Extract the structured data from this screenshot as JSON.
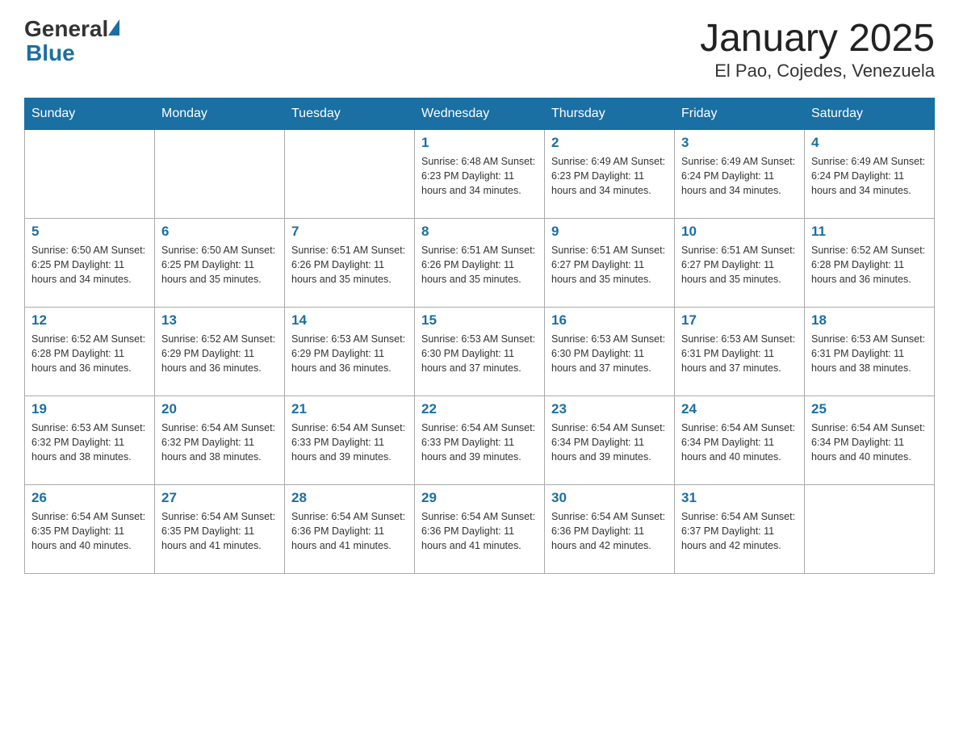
{
  "header": {
    "title": "January 2025",
    "subtitle": "El Pao, Cojedes, Venezuela"
  },
  "logo": {
    "general": "General",
    "blue": "Blue"
  },
  "days_of_week": [
    "Sunday",
    "Monday",
    "Tuesday",
    "Wednesday",
    "Thursday",
    "Friday",
    "Saturday"
  ],
  "weeks": [
    [
      {
        "day": "",
        "info": ""
      },
      {
        "day": "",
        "info": ""
      },
      {
        "day": "",
        "info": ""
      },
      {
        "day": "1",
        "info": "Sunrise: 6:48 AM\nSunset: 6:23 PM\nDaylight: 11 hours\nand 34 minutes."
      },
      {
        "day": "2",
        "info": "Sunrise: 6:49 AM\nSunset: 6:23 PM\nDaylight: 11 hours\nand 34 minutes."
      },
      {
        "day": "3",
        "info": "Sunrise: 6:49 AM\nSunset: 6:24 PM\nDaylight: 11 hours\nand 34 minutes."
      },
      {
        "day": "4",
        "info": "Sunrise: 6:49 AM\nSunset: 6:24 PM\nDaylight: 11 hours\nand 34 minutes."
      }
    ],
    [
      {
        "day": "5",
        "info": "Sunrise: 6:50 AM\nSunset: 6:25 PM\nDaylight: 11 hours\nand 34 minutes."
      },
      {
        "day": "6",
        "info": "Sunrise: 6:50 AM\nSunset: 6:25 PM\nDaylight: 11 hours\nand 35 minutes."
      },
      {
        "day": "7",
        "info": "Sunrise: 6:51 AM\nSunset: 6:26 PM\nDaylight: 11 hours\nand 35 minutes."
      },
      {
        "day": "8",
        "info": "Sunrise: 6:51 AM\nSunset: 6:26 PM\nDaylight: 11 hours\nand 35 minutes."
      },
      {
        "day": "9",
        "info": "Sunrise: 6:51 AM\nSunset: 6:27 PM\nDaylight: 11 hours\nand 35 minutes."
      },
      {
        "day": "10",
        "info": "Sunrise: 6:51 AM\nSunset: 6:27 PM\nDaylight: 11 hours\nand 35 minutes."
      },
      {
        "day": "11",
        "info": "Sunrise: 6:52 AM\nSunset: 6:28 PM\nDaylight: 11 hours\nand 36 minutes."
      }
    ],
    [
      {
        "day": "12",
        "info": "Sunrise: 6:52 AM\nSunset: 6:28 PM\nDaylight: 11 hours\nand 36 minutes."
      },
      {
        "day": "13",
        "info": "Sunrise: 6:52 AM\nSunset: 6:29 PM\nDaylight: 11 hours\nand 36 minutes."
      },
      {
        "day": "14",
        "info": "Sunrise: 6:53 AM\nSunset: 6:29 PM\nDaylight: 11 hours\nand 36 minutes."
      },
      {
        "day": "15",
        "info": "Sunrise: 6:53 AM\nSunset: 6:30 PM\nDaylight: 11 hours\nand 37 minutes."
      },
      {
        "day": "16",
        "info": "Sunrise: 6:53 AM\nSunset: 6:30 PM\nDaylight: 11 hours\nand 37 minutes."
      },
      {
        "day": "17",
        "info": "Sunrise: 6:53 AM\nSunset: 6:31 PM\nDaylight: 11 hours\nand 37 minutes."
      },
      {
        "day": "18",
        "info": "Sunrise: 6:53 AM\nSunset: 6:31 PM\nDaylight: 11 hours\nand 38 minutes."
      }
    ],
    [
      {
        "day": "19",
        "info": "Sunrise: 6:53 AM\nSunset: 6:32 PM\nDaylight: 11 hours\nand 38 minutes."
      },
      {
        "day": "20",
        "info": "Sunrise: 6:54 AM\nSunset: 6:32 PM\nDaylight: 11 hours\nand 38 minutes."
      },
      {
        "day": "21",
        "info": "Sunrise: 6:54 AM\nSunset: 6:33 PM\nDaylight: 11 hours\nand 39 minutes."
      },
      {
        "day": "22",
        "info": "Sunrise: 6:54 AM\nSunset: 6:33 PM\nDaylight: 11 hours\nand 39 minutes."
      },
      {
        "day": "23",
        "info": "Sunrise: 6:54 AM\nSunset: 6:34 PM\nDaylight: 11 hours\nand 39 minutes."
      },
      {
        "day": "24",
        "info": "Sunrise: 6:54 AM\nSunset: 6:34 PM\nDaylight: 11 hours\nand 40 minutes."
      },
      {
        "day": "25",
        "info": "Sunrise: 6:54 AM\nSunset: 6:34 PM\nDaylight: 11 hours\nand 40 minutes."
      }
    ],
    [
      {
        "day": "26",
        "info": "Sunrise: 6:54 AM\nSunset: 6:35 PM\nDaylight: 11 hours\nand 40 minutes."
      },
      {
        "day": "27",
        "info": "Sunrise: 6:54 AM\nSunset: 6:35 PM\nDaylight: 11 hours\nand 41 minutes."
      },
      {
        "day": "28",
        "info": "Sunrise: 6:54 AM\nSunset: 6:36 PM\nDaylight: 11 hours\nand 41 minutes."
      },
      {
        "day": "29",
        "info": "Sunrise: 6:54 AM\nSunset: 6:36 PM\nDaylight: 11 hours\nand 41 minutes."
      },
      {
        "day": "30",
        "info": "Sunrise: 6:54 AM\nSunset: 6:36 PM\nDaylight: 11 hours\nand 42 minutes."
      },
      {
        "day": "31",
        "info": "Sunrise: 6:54 AM\nSunset: 6:37 PM\nDaylight: 11 hours\nand 42 minutes."
      },
      {
        "day": "",
        "info": ""
      }
    ]
  ]
}
